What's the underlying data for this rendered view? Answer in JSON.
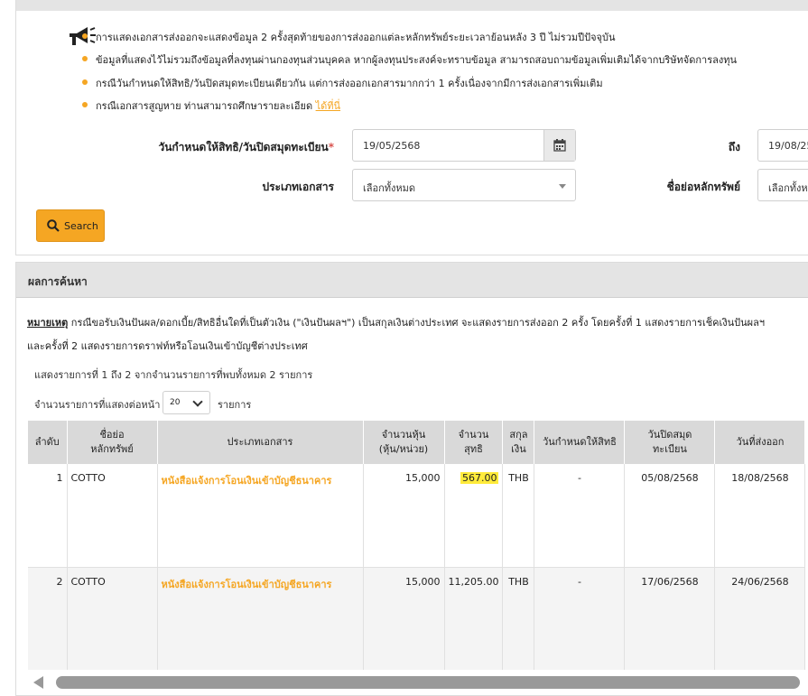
{
  "notes": [
    "การแสดงเอกสารส่งออกจะแสดงข้อมูล 2 ครั้งสุดท้ายของการส่งออกแต่ละหลักทรัพย์ระยะเวลาย้อนหลัง 3 ปี ไม่รวมปีปัจจุบัน",
    "ข้อมูลที่แสดงไว้ไม่รวมถึงข้อมูลที่ลงทุนผ่านกองทุนส่วนบุคคล หากผู้ลงทุนประสงค์จะทราบข้อมูล สามารถสอบถามข้อมูลเพิ่มเติมได้จากบริษัทจัดการลงทุน",
    "กรณีวันกำหนดให้สิทธิ/วันปิดสมุดทะเบียนเดียวกัน แต่การส่งออกเอกสารมากกว่า 1 ครั้งเนื่องจากมีการส่งเอกสารเพิ่มเติม",
    "กรณีเอกสารสูญหาย ท่านสามารถศึกษารายละเอียด"
  ],
  "note_link": "ได้ที่นี่",
  "form": {
    "date_label": "วันกำหนดให้สิทธิ/วันปิดสมุดทะเบียน",
    "required_mark": "*",
    "date_from": "19/05/2568",
    "to_label": "ถึง",
    "date_to": "19/08/25",
    "doctype_label": "ประเภทเอกสาร",
    "doctype_value": "เลือกทั้งหมด",
    "symbol_label": "ชื่อย่อหลักทรัพย์",
    "symbol_value": "เลือกทั้งหม",
    "search_label": "Search"
  },
  "results": {
    "title": "ผลการค้นหา",
    "remark_label": "หมายเหตุ",
    "remark_line1": "กรณีขอรับเงินปันผล/ดอกเบี้ย/สิทธิอื่นใดที่เป็นตัวเงิน (\"เงินปันผลฯ\") เป็นสกุลเงินต่างประเทศ จะแสดงรายการส่งออก 2 ครั้ง โดยครั้งที่ 1 แสดงรายการเช็คเงินปันผลฯ",
    "remark_line2": "และครั้งที่ 2 แสดงรายการดราฟท์หรือโอนเงินเข้าบัญชีต่างประเทศ",
    "showing": "แสดงรายการที่ 1 ถึง 2 จากจำนวนรายการที่พบทั้งหมด 2 รายการ",
    "per_page_label": "จำนวนรายการที่แสดงต่อหน้า",
    "per_page_value": "20",
    "per_page_unit": "รายการ"
  },
  "table": {
    "headers": {
      "no": "ลำดับ",
      "symbol1": "ชื่อย่อ",
      "symbol2": "หลักทรัพย์",
      "doctype": "ประเภทเอกสาร",
      "shares1": "จำนวนหุ้น",
      "shares2": "(หุ้น/หน่วย)",
      "net1": "จำนวน",
      "net2": "สุทธิ",
      "cur1": "สกุล",
      "cur2": "เงิน",
      "xdate": "วันกำหนดให้สิทธิ",
      "book1": "วันปิดสมุด",
      "book2": "ทะเบียน",
      "sent": "วันที่ส่งออก"
    },
    "rows": [
      {
        "no": "1",
        "symbol": "COTTO",
        "doctype": "หนังสือแจ้งการโอนเงินเข้าบัญชีธนาคาร",
        "shares": "15,000",
        "net": "567.00",
        "currency": "THB",
        "xdate": "-",
        "book": "05/08/2568",
        "sent": "18/08/2568"
      },
      {
        "no": "2",
        "symbol": "COTTO",
        "doctype": "หนังสือแจ้งการโอนเงินเข้าบัญชีธนาคาร",
        "shares": "15,000",
        "net": "11,205.00",
        "currency": "THB",
        "xdate": "-",
        "book": "17/06/2568",
        "sent": "24/06/2568"
      }
    ]
  },
  "icons": {
    "announce": "megaphone-icon",
    "calendar": "calendar-icon",
    "search": "search-icon"
  },
  "colors": {
    "accent": "#f5a623",
    "highlight": "#ffeb3b",
    "required": "#d9534f"
  }
}
